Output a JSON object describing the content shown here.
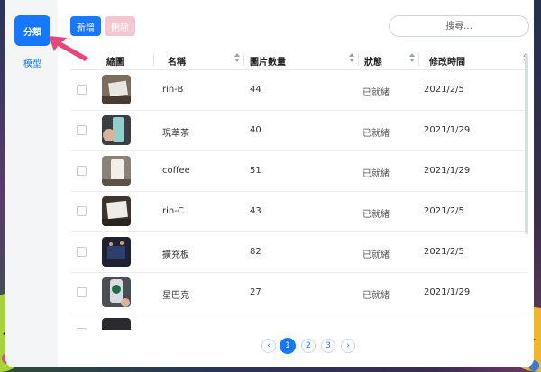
{
  "sidebar": {
    "items": [
      {
        "label": "分類"
      },
      {
        "label": "模型"
      }
    ]
  },
  "toolbar": {
    "add_label": "新增",
    "delete_label": "刪除",
    "search_placeholder": "搜尋..."
  },
  "table": {
    "headers": {
      "thumbnail": "縮圖",
      "name": "名稱",
      "count": "圖片數量",
      "status": "狀態",
      "modified": "修改時間"
    },
    "rows": [
      {
        "name": "rin-B",
        "count": "44",
        "status": "已就緒",
        "modified": "2021/2/5"
      },
      {
        "name": "現萃茶",
        "count": "40",
        "status": "已就緒",
        "modified": "2021/1/29"
      },
      {
        "name": "coffee",
        "count": "51",
        "status": "已就緒",
        "modified": "2021/1/29"
      },
      {
        "name": "rin-C",
        "count": "43",
        "status": "已就緒",
        "modified": "2021/2/5"
      },
      {
        "name": "擴充板",
        "count": "82",
        "status": "已就緒",
        "modified": "2021/2/5"
      },
      {
        "name": "星巴克",
        "count": "27",
        "status": "已就緒",
        "modified": "2021/1/29"
      }
    ]
  },
  "pagination": {
    "pages": [
      "1",
      "2",
      "3"
    ],
    "current": "1"
  },
  "colors": {
    "accent": "#1677ff",
    "danger_disabled": "#f6c6d0",
    "pointer": "#e8457a"
  }
}
